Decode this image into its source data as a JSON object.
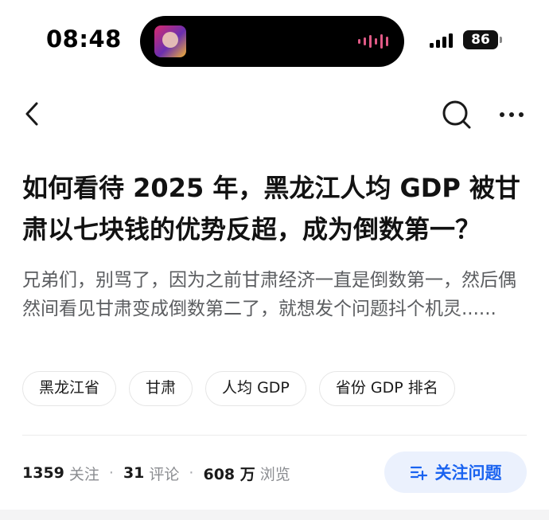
{
  "status_bar": {
    "time": "08:48",
    "battery": "86",
    "island_art_icon": "now-playing-cover-icon",
    "wave_icon": "audio-wave-icon",
    "signal_icon": "cellular-signal-icon"
  },
  "nav": {
    "back_icon": "chevron-left-icon",
    "search_icon": "search-icon",
    "more_icon": "more-horizontal-icon"
  },
  "question": {
    "title": "如何看待 2025 年，黑龙江人均 GDP 被甘肃以七块钱的优势反超，成为倒数第一？",
    "excerpt": "兄弟们，别骂了，因为之前甘肃经济一直是倒数第一，然后偶然间看见甘肃变成倒数第二了，就想发个问题抖个机灵......"
  },
  "tags": [
    "黑龙江省",
    "甘肃",
    "人均 GDP",
    "省份 GDP 排名"
  ],
  "stats": {
    "followers_count": "1359",
    "followers_label": "关注",
    "comments_count": "31",
    "comments_label": "评论",
    "views_count": "608 万",
    "views_label": "浏览",
    "separator": "·"
  },
  "follow_button": {
    "label": "关注问题",
    "icon": "follow-list-plus-icon"
  },
  "colors": {
    "accent": "#1a63f0",
    "accent_bg": "#ebf1fd",
    "text_primary": "#121212",
    "text_secondary": "#5b5d60",
    "text_muted": "#8a8c90"
  }
}
